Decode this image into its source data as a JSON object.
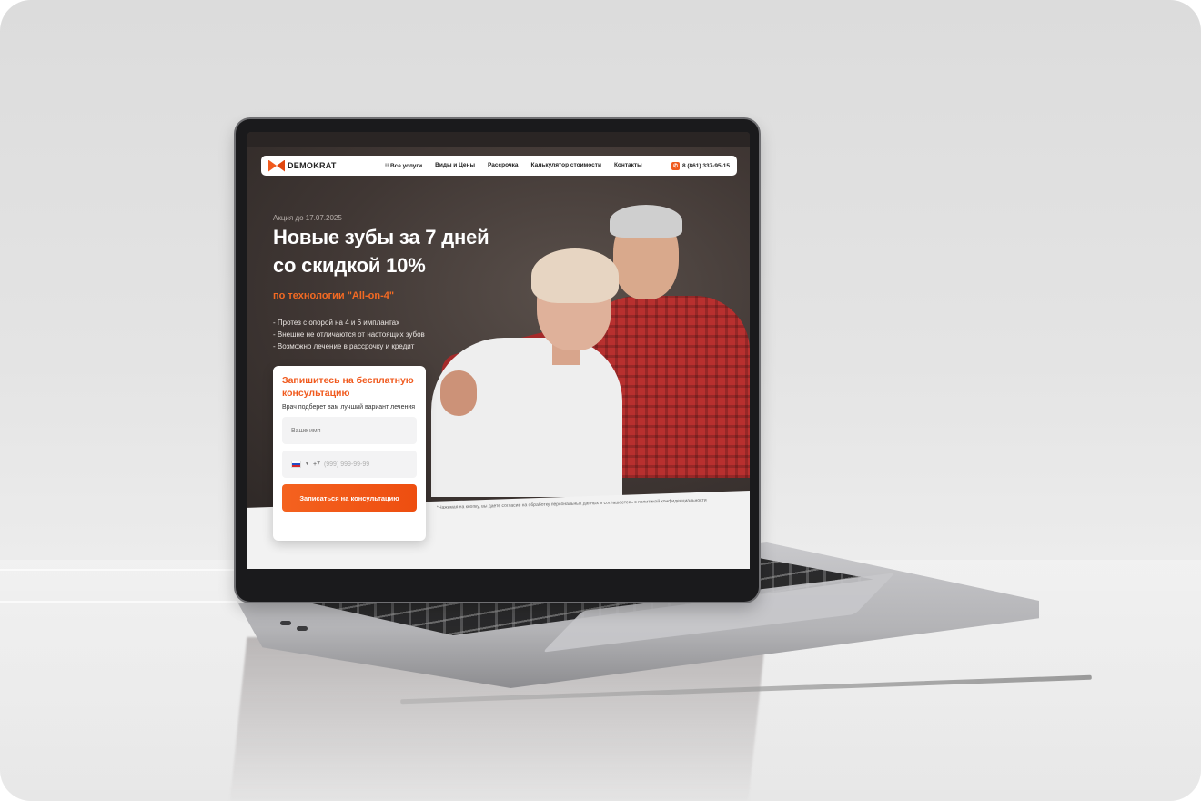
{
  "nav": {
    "logo_text": "DEMOKRAT",
    "links": [
      "Все услуги",
      "Виды и Цены",
      "Рассрочка",
      "Калькулятор стоимости",
      "Контакты"
    ],
    "all_services_icon": "grid-icon",
    "phone": "8 (861) 337-95-15"
  },
  "hero": {
    "promo": "Акция до 17.07.2025",
    "headline_line1": "Новые зубы за 7 дней",
    "headline_line2": "со скидкой 10%",
    "tech": "по технологии \"All-on-4\"",
    "bullets": [
      "- Протез с опорой на 4 и 6 имплантах",
      "- Внешне не отличаются от настоящих зубов",
      "- Возможно лечение в рассрочку и кредит"
    ]
  },
  "form": {
    "title": "Запишитесь на бесплатную консультацию",
    "subtitle": "Врач подберет вам лучший вариант лечения",
    "name_placeholder": "Ваше имя",
    "phone_code": "+7",
    "phone_placeholder": "(999) 999-99-99",
    "submit_label": "Записаться на консультацию"
  },
  "consent": "*Нажимая на кнопку, вы даете согласие на обработку персональных данных и соглашаетесь с политикой конфиденциальности",
  "colors": {
    "accent": "#f05a1e",
    "hero_bg": "#3c3532"
  }
}
